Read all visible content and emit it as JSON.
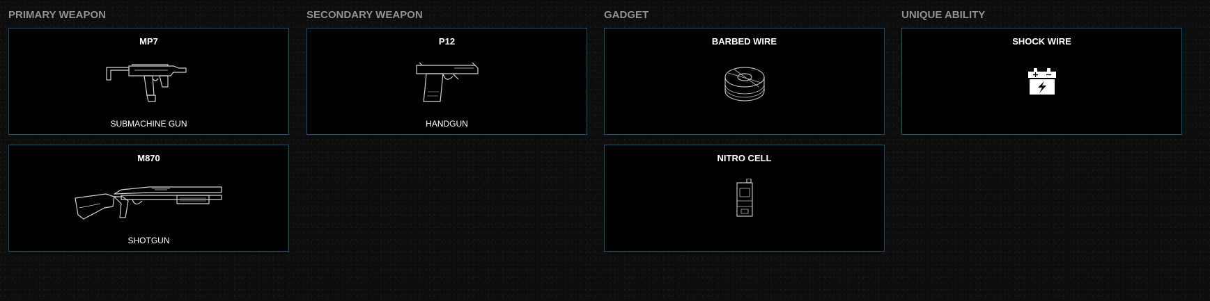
{
  "columns": [
    {
      "title": "PRIMARY WEAPON",
      "cards": [
        {
          "name": "MP7",
          "type": "SUBMACHINE GUN",
          "icon": "submachine-gun-icon"
        },
        {
          "name": "M870",
          "type": "SHOTGUN",
          "icon": "shotgun-icon"
        }
      ]
    },
    {
      "title": "SECONDARY WEAPON",
      "cards": [
        {
          "name": "P12",
          "type": "HANDGUN",
          "icon": "handgun-icon"
        }
      ]
    },
    {
      "title": "GADGET",
      "cards": [
        {
          "name": "BARBED WIRE",
          "icon": "barbed-wire-icon"
        },
        {
          "name": "NITRO CELL",
          "icon": "nitro-cell-icon"
        }
      ]
    },
    {
      "title": "UNIQUE ABILITY",
      "cards": [
        {
          "name": "SHOCK WIRE",
          "icon": "shock-wire-icon"
        }
      ]
    }
  ],
  "colors": {
    "background": "#0d0d0d",
    "card_background": "#000000",
    "card_border": "#1d4f6e",
    "heading": "#8f9296",
    "text": "#ffffff"
  }
}
